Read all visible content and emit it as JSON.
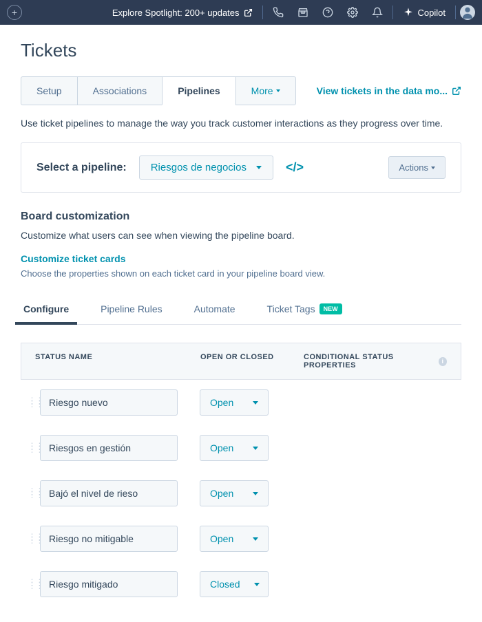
{
  "banner": {
    "spotlight": "Explore Spotlight: 200+ updates",
    "copilot": "Copilot"
  },
  "page": {
    "title": "Tickets",
    "description": "Use ticket pipelines to manage the way you track customer interactions as they progress over time."
  },
  "tabs": [
    "Setup",
    "Associations",
    "Pipelines",
    "More"
  ],
  "data_link": "View tickets in the data mo...",
  "pipeline": {
    "label": "Select a pipeline:",
    "selected": "Riesgos de negocios",
    "actions": "Actions"
  },
  "board": {
    "title": "Board customization",
    "desc": "Customize what users can see when viewing the pipeline board.",
    "link_title": "Customize ticket cards",
    "sub_desc": "Choose the properties shown on each ticket card in your pipeline board view."
  },
  "subtabs": {
    "configure": "Configure",
    "rules": "Pipeline Rules",
    "automate": "Automate",
    "tags": "Ticket Tags",
    "new_badge": "NEW"
  },
  "table": {
    "headers": {
      "name": "STATUS NAME",
      "open_closed": "OPEN OR CLOSED",
      "conditional": "CONDITIONAL STATUS PROPERTIES"
    },
    "rows": [
      {
        "name": "Riesgo nuevo",
        "status": "Open"
      },
      {
        "name": "Riesgos en gestión",
        "status": "Open"
      },
      {
        "name": "Bajó el nivel de rieso",
        "status": "Open"
      },
      {
        "name": "Riesgo no mitigable",
        "status": "Open"
      },
      {
        "name": "Riesgo mitigado",
        "status": "Closed"
      }
    ]
  }
}
